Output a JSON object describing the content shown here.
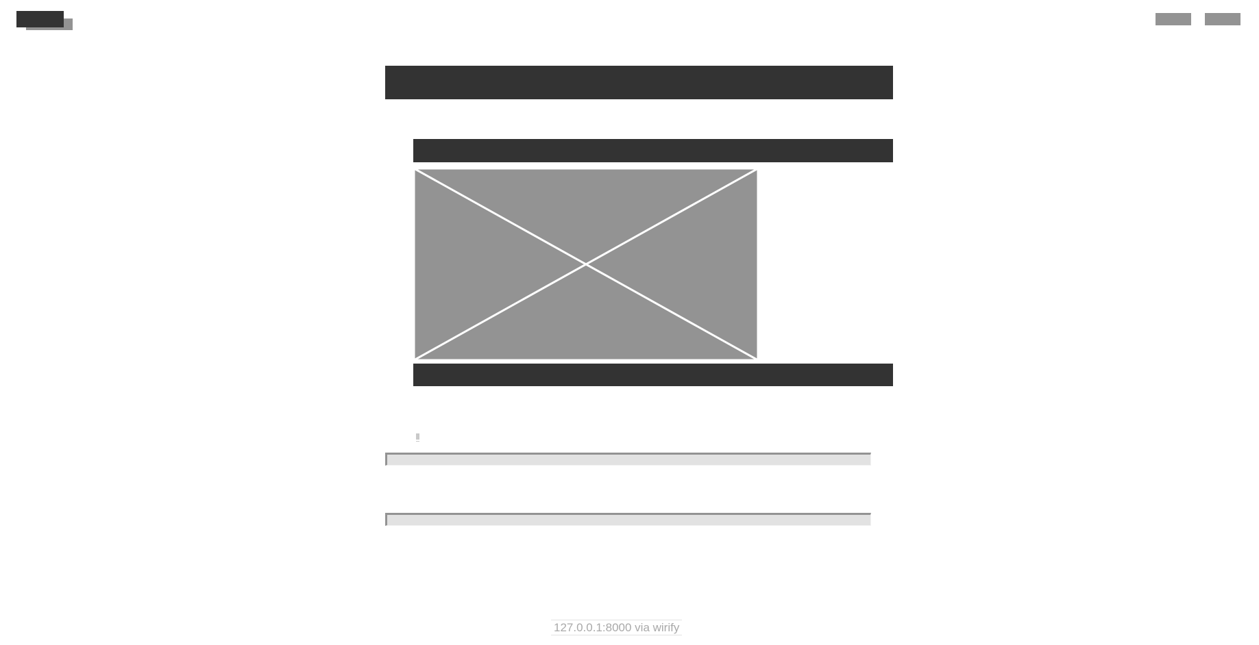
{
  "header": {
    "logo_icon": "logo-placeholder-icon",
    "nav_items": [
      "",
      ""
    ]
  },
  "main": {
    "image_icon": "image-placeholder-icon",
    "fields": [
      "",
      ""
    ]
  },
  "footer": {
    "source_text": "127.0.0.1:8000 via wirify"
  },
  "colors": {
    "dark_block": "#333333",
    "mid_gray": "#939393",
    "light_field": "#e2e2e2",
    "footer_text": "#a9a9a9"
  }
}
